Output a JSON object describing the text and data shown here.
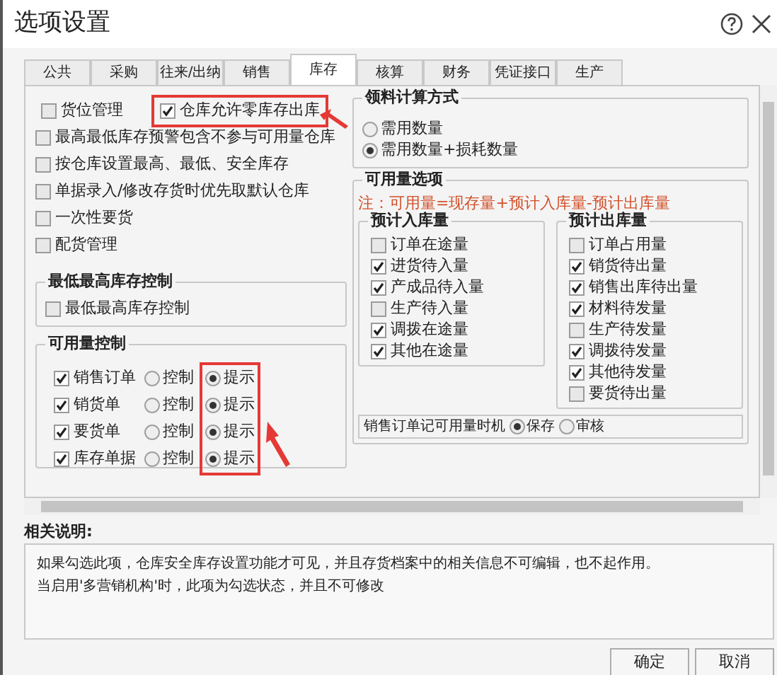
{
  "window": {
    "title": "选项设置"
  },
  "tabs": [
    {
      "label": "公共",
      "selected": false
    },
    {
      "label": "采购",
      "selected": false
    },
    {
      "label": "往来/出纳",
      "selected": false
    },
    {
      "label": "销售",
      "selected": false
    },
    {
      "label": "库存",
      "selected": true
    },
    {
      "label": "核算",
      "selected": false
    },
    {
      "label": "财务",
      "selected": false
    },
    {
      "label": "凭证接口",
      "selected": false
    },
    {
      "label": "生产",
      "selected": false
    }
  ],
  "top_row": [
    {
      "label": "货位管理",
      "checked": false,
      "highlighted": false
    },
    {
      "label": "仓库允许零库存出库",
      "checked": true,
      "highlighted": true
    }
  ],
  "options": [
    {
      "label": "最高最低库存预警包含不参与可用量仓库",
      "checked": false
    },
    {
      "label": "按仓库设置最高、最低、安全库存",
      "checked": false
    },
    {
      "label": "单据录入/修改存货时优先取默认仓库",
      "checked": false
    },
    {
      "label": "一次性要货",
      "checked": false
    },
    {
      "label": "配货管理",
      "checked": false
    }
  ],
  "min_max_group": {
    "title": "最低最高库存控制",
    "options": [
      {
        "label": "最低最高库存控制",
        "checked": false
      }
    ]
  },
  "availability_control": {
    "title": "可用量控制",
    "columns": [
      {
        "highlighted": false
      },
      {
        "highlighted": true
      }
    ],
    "rows": [
      {
        "label": "销售订单",
        "checked": true,
        "modes": [
          {
            "label": "控制",
            "selected": false
          },
          {
            "label": "提示",
            "selected": true
          }
        ]
      },
      {
        "label": "销货单",
        "checked": true,
        "modes": [
          {
            "label": "控制",
            "selected": false
          },
          {
            "label": "提示",
            "selected": true
          }
        ]
      },
      {
        "label": "要货单",
        "checked": true,
        "modes": [
          {
            "label": "控制",
            "selected": false
          },
          {
            "label": "提示",
            "selected": true
          }
        ]
      },
      {
        "label": "库存单据",
        "checked": true,
        "modes": [
          {
            "label": "控制",
            "selected": false
          },
          {
            "label": "提示",
            "selected": true
          }
        ]
      }
    ]
  },
  "calc_method": {
    "title": "领料计算方式",
    "options": [
      {
        "label": "需用数量",
        "selected": false
      },
      {
        "label": "需用数量+损耗数量",
        "selected": true
      }
    ]
  },
  "availability_options": {
    "title": "可用量选项",
    "note": "注：可用量=现存量+预计入库量-预计出库量",
    "inbound": {
      "title": "预计入库量",
      "options": [
        {
          "label": "订单在途量",
          "checked": false
        },
        {
          "label": "进货待入量",
          "checked": true
        },
        {
          "label": "产成品待入量",
          "checked": true
        },
        {
          "label": "生产待入量",
          "checked": false
        },
        {
          "label": "调拨在途量",
          "checked": true
        },
        {
          "label": "其他在途量",
          "checked": true
        }
      ]
    },
    "outbound": {
      "title": "预计出库量",
      "options": [
        {
          "label": "订单占用量",
          "checked": false
        },
        {
          "label": "销货待出量",
          "checked": true
        },
        {
          "label": "销售出库待出量",
          "checked": true
        },
        {
          "label": "材料待发量",
          "checked": true
        },
        {
          "label": "生产待发量",
          "checked": false
        },
        {
          "label": "调拨待发量",
          "checked": true
        },
        {
          "label": "其他待发量",
          "checked": true
        },
        {
          "label": "要货待出量",
          "checked": false
        }
      ]
    },
    "timing": {
      "label": "销售订单记可用量时机",
      "options": [
        {
          "label": "保存",
          "selected": true
        },
        {
          "label": "审核",
          "selected": false
        }
      ]
    }
  },
  "description": {
    "title": "相关说明:",
    "lines": [
      "如果勾选此项，仓库安全库存设置功能才可见，并且存货档案中的相关信息不可编辑，也不起作用。",
      "当启用'多营销机构'时，此项为勾选状态，并且不可修改"
    ]
  },
  "buttons": [
    "确定",
    "取消"
  ]
}
